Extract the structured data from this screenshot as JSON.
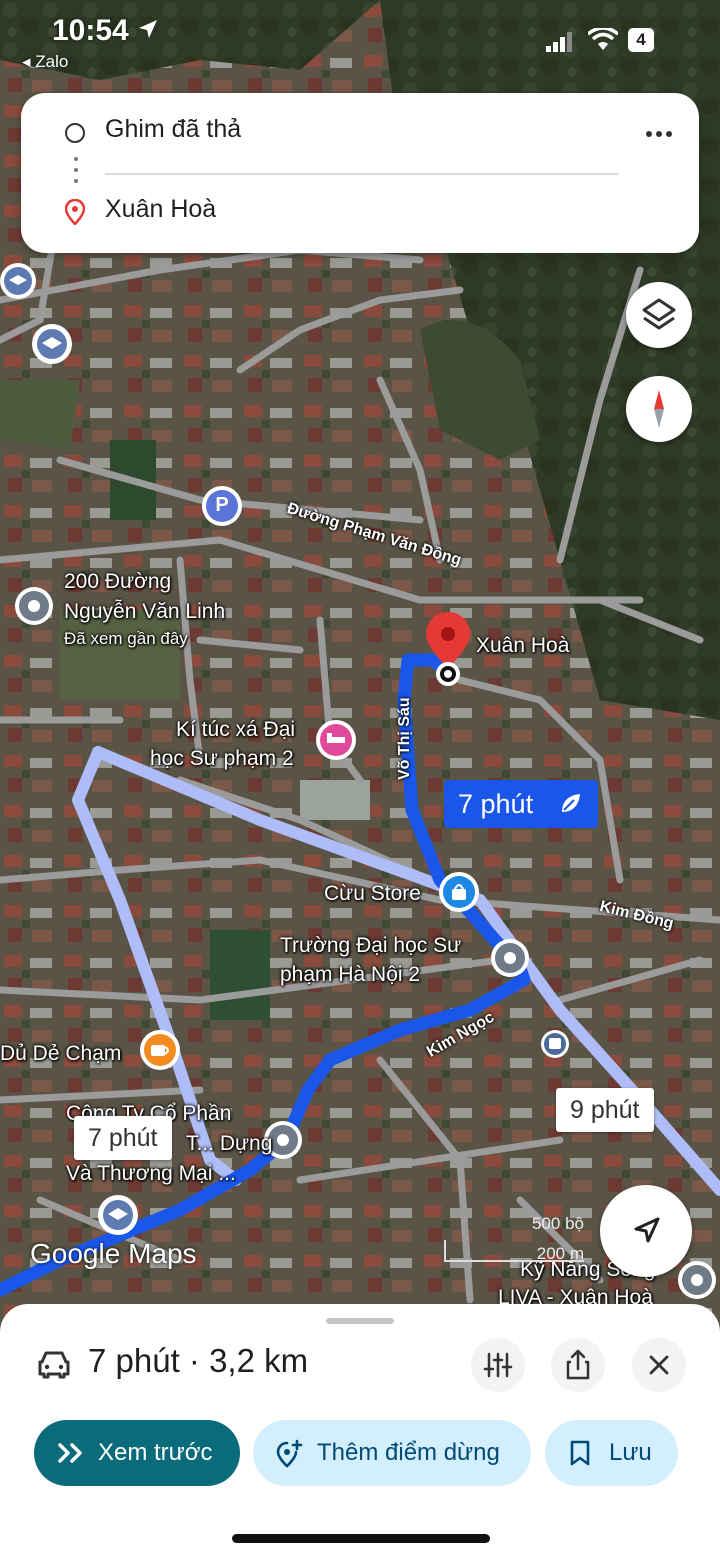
{
  "status_bar": {
    "time": "10:54",
    "back_app": "◂ Zalo",
    "battery": "4"
  },
  "route_card": {
    "origin": "Ghim đã thả",
    "destination": "Xuân Hoà"
  },
  "map": {
    "places": {
      "address_1": "200 Đường",
      "address_2": "Nguyễn Văn Linh",
      "address_note": "Đã xem gần đây",
      "dorm_1": "Kí túc xá Đại",
      "dorm_2": "học Sư phạm 2",
      "destination": "Xuân Hoà",
      "store": "Cừu Store",
      "univ_1": "Trường Đại học Sư",
      "univ_2": "phạm Hà Nội 2",
      "cafe": "Dủ Dẻ Chạm",
      "company_1": "Công Ty Cổ Phần",
      "company_2": "T... Dựng",
      "company_3": "Và Thương Mại ...",
      "skills_1": "Kỹ Năng Sống",
      "skills_2": "LIVA - Xuân Hoà"
    },
    "streets": {
      "pham_van_dong": "Đường Phạm Văn Đồng",
      "vo_thi_sau": "Võ Thị Sáu",
      "kim_dong": "Kim Đồng",
      "kim_ngoc": "Kim Ngọc"
    },
    "route_badges": {
      "main": "7 phút",
      "alt_left": "7 phút",
      "alt_right": "9 phút"
    },
    "logo": "Google Maps",
    "scale": {
      "imperial": "500 bộ",
      "metric": "200 m"
    },
    "parking_label": "P",
    "colors": {
      "route_primary": "#1a56e8",
      "route_alt": "#aebcf7",
      "pin": "#e53935"
    }
  },
  "bottom_sheet": {
    "summary": "7 phút · 3,2 km",
    "preview_label": "Xem trước",
    "add_stop_label": "Thêm điểm dừng",
    "save_label": "Lưu"
  }
}
